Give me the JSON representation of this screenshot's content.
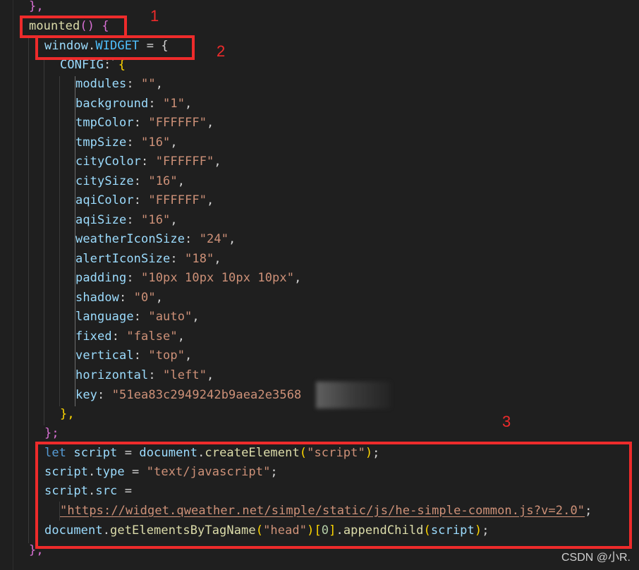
{
  "code": {
    "close_prev": "},",
    "mounted_fn": "mounted",
    "mounted_open": "() {",
    "window_obj": "window",
    "widget_prop": "WIDGET",
    "assign_open": " = {",
    "config_key": "CONFIG",
    "config_open": "{",
    "entries": [
      {
        "key": "modules",
        "value": "\"\""
      },
      {
        "key": "background",
        "value": "\"1\""
      },
      {
        "key": "tmpColor",
        "value": "\"FFFFFF\""
      },
      {
        "key": "tmpSize",
        "value": "\"16\""
      },
      {
        "key": "cityColor",
        "value": "\"FFFFFF\""
      },
      {
        "key": "citySize",
        "value": "\"16\""
      },
      {
        "key": "aqiColor",
        "value": "\"FFFFFF\""
      },
      {
        "key": "aqiSize",
        "value": "\"16\""
      },
      {
        "key": "weatherIconSize",
        "value": "\"24\""
      },
      {
        "key": "alertIconSize",
        "value": "\"18\""
      },
      {
        "key": "padding",
        "value": "\"10px 10px 10px 10px\""
      },
      {
        "key": "shadow",
        "value": "\"0\""
      },
      {
        "key": "language",
        "value": "\"auto\""
      },
      {
        "key": "fixed",
        "value": "\"false\""
      },
      {
        "key": "vertical",
        "value": "\"top\""
      },
      {
        "key": "horizontal",
        "value": "\"left\""
      }
    ],
    "api_key_name": "key",
    "api_key_value": "\"51ea83c2949242b9aea2e3568",
    "config_close": "},",
    "widget_close": "};",
    "let_kw": "let",
    "script_var": "script",
    "document_obj": "document",
    "create_fn": "createElement",
    "create_arg": "\"script\"",
    "type_prop": "type",
    "type_value": "\"text/javascript\"",
    "src_prop": "src",
    "src_url": "\"https://widget.qweather.net/simple/static/js/he-simple-common.js?v=2.0\"",
    "get_fn": "getElementsByTagName",
    "head_arg": "\"head\"",
    "index_num": "0",
    "append_fn": "appendChild",
    "mounted_close": "},"
  },
  "annotations": {
    "label_1": "1",
    "label_2": "2",
    "label_3": "3",
    "color": "#ee2b2b"
  },
  "watermark": "CSDN @小R."
}
